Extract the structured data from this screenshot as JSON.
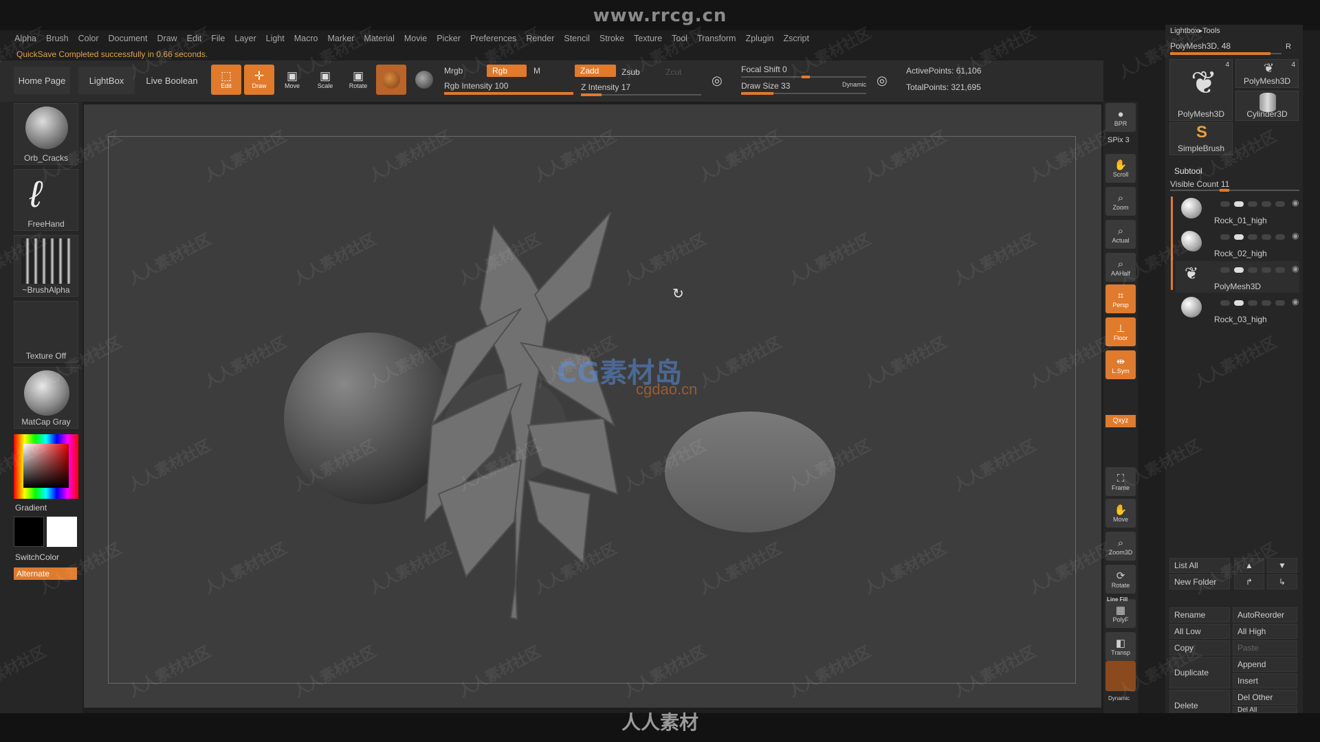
{
  "watermark_top": "www.rrcg.cn",
  "watermark_center": "CG素材岛",
  "watermark_center_sub": "cgdao.cn",
  "watermark_bottom": "人人素材",
  "watermark_tile": "人人素材社区",
  "menu": [
    "Alpha",
    "Brush",
    "Color",
    "Document",
    "Draw",
    "Edit",
    "File",
    "Layer",
    "Light",
    "Macro",
    "Marker",
    "Material",
    "Movie",
    "Picker",
    "Preferences",
    "Render",
    "Stencil",
    "Stroke",
    "Texture",
    "Tool",
    "Transform",
    "Zplugin",
    "Zscript"
  ],
  "status_message": "QuickSave Completed successfully in 0.66 seconds.",
  "tabs": {
    "home": "Home Page",
    "lightbox": "LightBox",
    "live_boolean": "Live Boolean"
  },
  "tools": {
    "edit": "Edit",
    "draw": "Draw",
    "move": "Move",
    "scale": "Scale",
    "rotate": "Rotate"
  },
  "color_mode": {
    "mrgb": "Mrgb",
    "rgb": "Rgb",
    "m": "M",
    "rgb_intensity": "Rgb Intensity 100",
    "rgb_intensity_value": 100
  },
  "z_mode": {
    "zadd": "Zadd",
    "zsub": "Zsub",
    "zcut": "Zcut",
    "z_intensity": "Z Intensity 17",
    "z_intensity_value": 17
  },
  "brush": {
    "focal_shift": "Focal Shift 0",
    "draw_size": "Draw Size 33",
    "dynamic": "Dynamic",
    "draw_size_value": 33
  },
  "points": {
    "active": "ActivePoints: 61,106",
    "total": "TotalPoints: 321,695"
  },
  "left_shelf": {
    "brush_thumb": "Orb_Cracks",
    "stroke": "FreeHand",
    "alpha": "~BrushAlpha",
    "texture": "Texture Off",
    "material": "MatCap Gray",
    "gradient": "Gradient",
    "switch_color": "SwitchColor",
    "alternate": "Alternate"
  },
  "right_shelf": [
    {
      "label": "BPR",
      "icon": "bpr-icon",
      "on": false
    },
    {
      "label": "Scroll",
      "icon": "scroll-icon",
      "on": false
    },
    {
      "label": "Zoom",
      "icon": "zoom-icon",
      "on": false
    },
    {
      "label": "Actual",
      "icon": "actual-icon",
      "on": false
    },
    {
      "label": "AAHalf",
      "icon": "aahalf-icon",
      "on": false
    },
    {
      "label": "Persp",
      "icon": "persp-icon",
      "on": true
    },
    {
      "label": "Floor",
      "icon": "floor-icon",
      "on": true
    },
    {
      "label": "L.Sym",
      "icon": "lsym-icon",
      "on": true
    },
    {
      "label": "Frame",
      "icon": "frame-icon",
      "on": false
    },
    {
      "label": "Move",
      "icon": "move-icon",
      "on": false
    },
    {
      "label": "Zoom3D",
      "icon": "zoom3d-icon",
      "on": false
    },
    {
      "label": "Rotate",
      "icon": "rotate-icon",
      "on": false
    },
    {
      "label": "PolyF",
      "icon": "polyf-icon",
      "on": false
    },
    {
      "label": "Transp",
      "icon": "transp-icon",
      "on": false
    }
  ],
  "right_shelf_extra": {
    "spix": "SPix 3",
    "xyz": "Qxyz",
    "line_fill": "Line Fill",
    "dynamic": "Dynamic"
  },
  "tool_panel": {
    "header": "Lightbox▸Tools",
    "current_tool": "PolyMesh3D. 48",
    "r_button": "R",
    "tools": [
      {
        "name": "PolyMesh3D",
        "count": "4"
      },
      {
        "name": "PolyMesh3D",
        "count": "4"
      },
      {
        "name": "Cylinder3D",
        "count": ""
      },
      {
        "name": "SimpleBrush",
        "count": ""
      }
    ],
    "subtool_title": "Subtool",
    "visible_count": "Visible Count 11",
    "subtools": [
      "Rock_01_high",
      "Rock_02_high",
      "PolyMesh3D",
      "Rock_03_high"
    ]
  },
  "subtool_buttons": {
    "list_all": "List All",
    "new_folder": "New Folder",
    "rename": "Rename",
    "auto_reorder": "AutoReorder",
    "all_low": "All Low",
    "all_high": "All High",
    "copy": "Copy",
    "paste": "Paste",
    "duplicate": "Duplicate",
    "append": "Append",
    "insert": "Insert",
    "delete": "Delete",
    "del_other": "Del Other",
    "del_all": "Del All"
  },
  "colors": {
    "accent": "#e07a2c",
    "bg": "#1e1e1e",
    "panel": "#262626",
    "canvas": "#3d3d3d"
  }
}
